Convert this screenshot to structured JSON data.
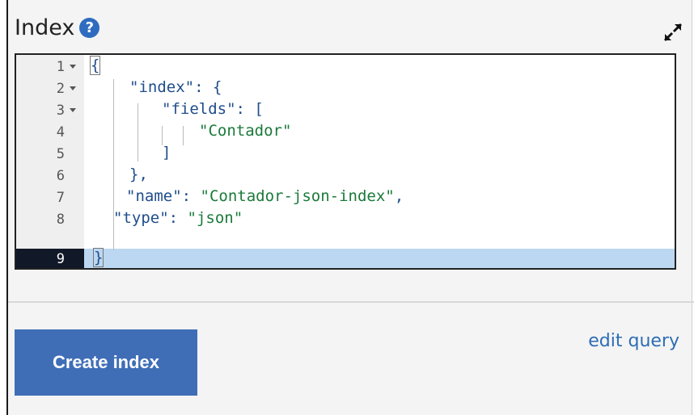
{
  "panel": {
    "title": "Index",
    "help_icon": "?",
    "expand_icon": "expand-icon"
  },
  "editor": {
    "lines": [
      {
        "number": "1",
        "fold": true,
        "text": "{"
      },
      {
        "number": "2",
        "fold": true,
        "text": "\"index\": {"
      },
      {
        "number": "3",
        "fold": true,
        "text": "\"fields\": ["
      },
      {
        "number": "4",
        "fold": false,
        "text": "\"Contador\""
      },
      {
        "number": "5",
        "fold": false,
        "text": "]"
      },
      {
        "number": "6",
        "fold": false,
        "text": "},"
      },
      {
        "number": "7",
        "fold": false,
        "text": "\"name\": \"Contador-json-index\","
      },
      {
        "number": "8",
        "fold": false,
        "text": "\"type\": \"json\""
      },
      {
        "number": "9",
        "fold": false,
        "text": "}"
      }
    ],
    "active_line": "9"
  },
  "actions": {
    "create_label": "Create index",
    "edit_query_label": "edit query"
  },
  "colors": {
    "accent": "#3f6eb7",
    "link": "#2d6db5",
    "string": "#1a7a3a",
    "key": "#1f4d8a",
    "active_line": "#bcd7f1"
  }
}
